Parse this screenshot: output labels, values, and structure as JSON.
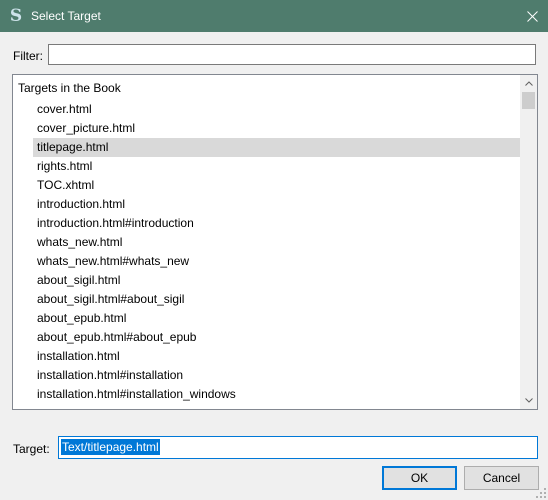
{
  "window": {
    "title": "Select Target",
    "app_icon_glyph": "S",
    "accent_color": "#4f7c6d"
  },
  "filter": {
    "label": "Filter:",
    "value": ""
  },
  "tree": {
    "header": "Targets in the Book",
    "items": [
      "cover.html",
      "cover_picture.html",
      "titlepage.html",
      "rights.html",
      "TOC.xhtml",
      "introduction.html",
      "introduction.html#introduction",
      "whats_new.html",
      "whats_new.html#whats_new",
      "about_sigil.html",
      "about_sigil.html#about_sigil",
      "about_epub.html",
      "about_epub.html#about_epub",
      "installation.html",
      "installation.html#installation",
      "installation.html#installation_windows"
    ],
    "selected_item": "titlepage.html"
  },
  "target": {
    "label": "Target:",
    "value": "Text/titlepage.html"
  },
  "buttons": {
    "ok": "OK",
    "cancel": "Cancel"
  }
}
